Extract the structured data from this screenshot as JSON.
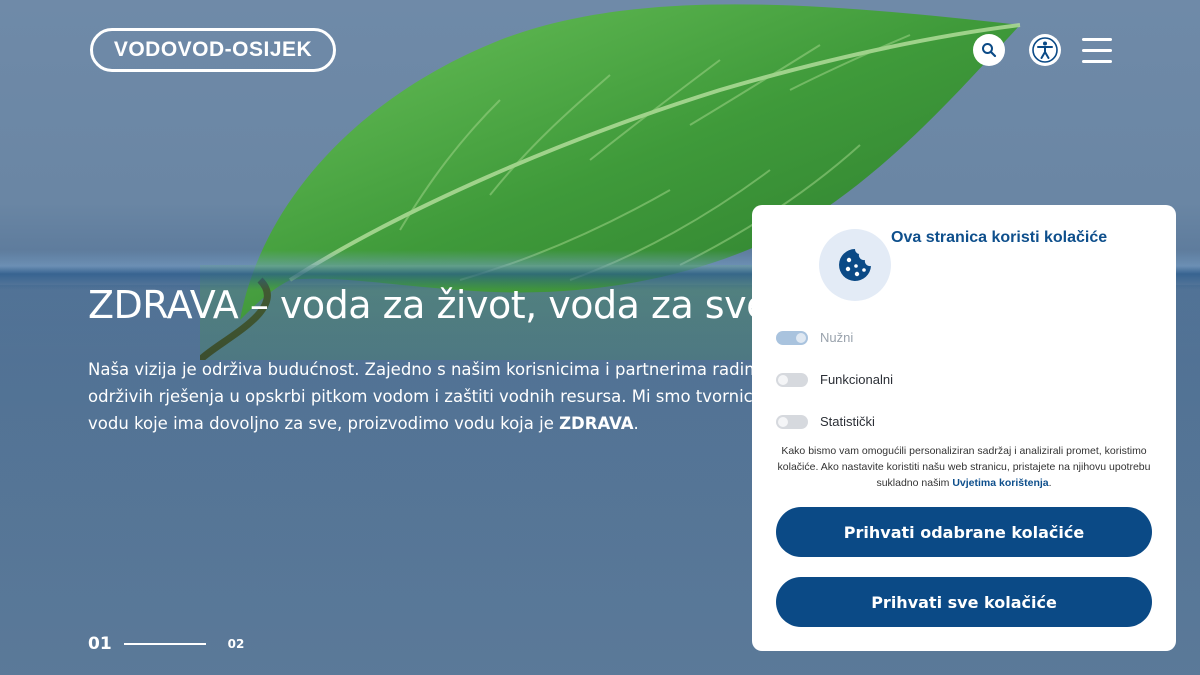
{
  "header": {
    "logo_text": "VODOVOD-OSIJEK",
    "search_icon": "search-icon",
    "accessibility_icon": "accessibility-icon",
    "menu_icon": "hamburger-menu-icon"
  },
  "hero": {
    "title": "ZDRAVA – voda za život, voda za sve",
    "text_lines": [
      "Naša vizija je održiva budućnost. Zajedno s našim korisnicima i partnerima radimo na stvaranju",
      "održivih rješenja u opskrbi pitkom vodom i zaštiti vodnih resursa. Mi smo tvornica koja proizvodi",
      "vodu koje ima dovoljno za sve, proizvodimo vodu koja je"
    ],
    "text_emphasis": "ZDRAVA",
    "text_end": "."
  },
  "pager": {
    "current": "01",
    "next": "02"
  },
  "cookie_banner": {
    "title": "Ova stranica koristi kolačiće",
    "icon": "cookie-icon",
    "options": [
      {
        "label": "Nužni",
        "enabled": true,
        "disabled": true
      },
      {
        "label": "Funkcionalni",
        "enabled": false,
        "disabled": false
      },
      {
        "label": "Statistički",
        "enabled": false,
        "disabled": false
      }
    ],
    "description_before_link": "Kako bismo vam omogućili personaliziran sadržaj i analizirali promet, koristimo kolačiće. Ako nastavite koristiti našu web stranicu, pristajete na njihovu upotrebu sukladno našim",
    "description_link": "Uvjetima korištenja",
    "description_after_link": ".",
    "accept_selected_label": "Prihvati odabrane kolačiće",
    "accept_all_label": "Prihvati sve kolačiće"
  },
  "colors": {
    "brand_blue": "#0b4a86",
    "title_blue": "#0e4f8c",
    "leaf_green": "#3f9a3a"
  }
}
